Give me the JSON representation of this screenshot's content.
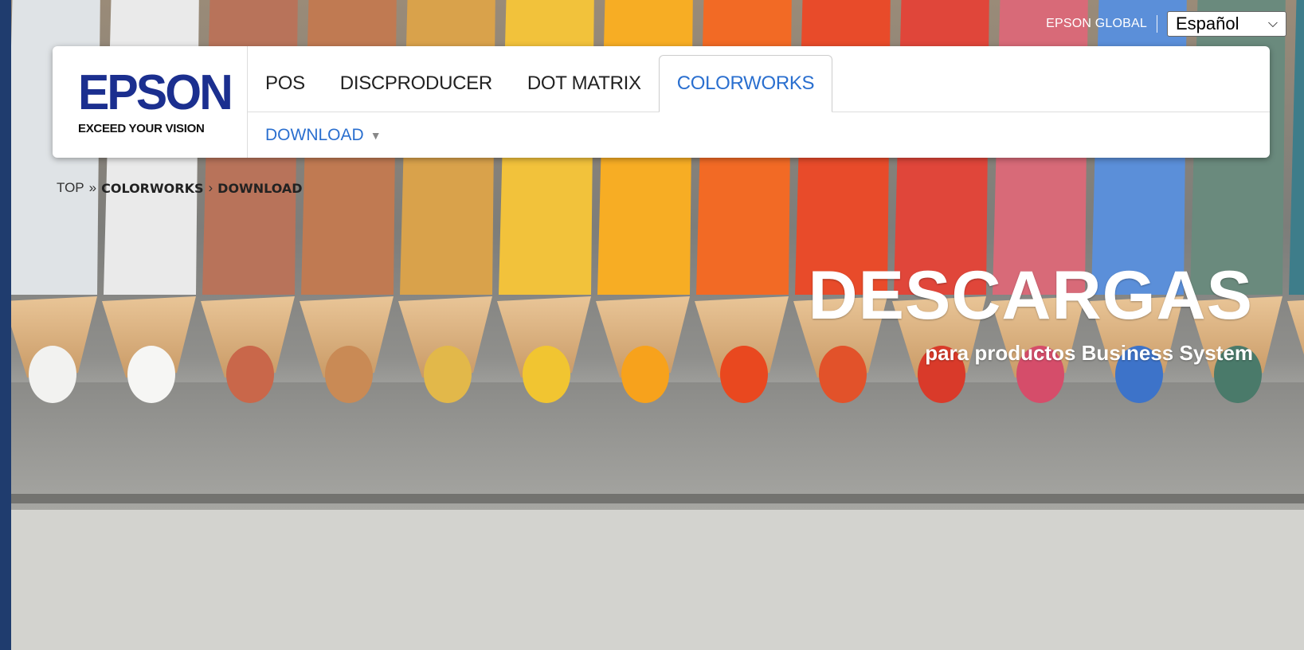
{
  "utility": {
    "global_link": "EPSON GLOBAL",
    "language_selected": "Español"
  },
  "logo": {
    "wordmark": "EPSON",
    "tagline": "EXCEED YOUR VISION"
  },
  "nav": {
    "items": [
      {
        "label": "POS",
        "active": false
      },
      {
        "label": "DISCPRODUCER",
        "active": false
      },
      {
        "label": "DOT MATRIX",
        "active": false
      },
      {
        "label": "COLORWORKS",
        "active": true
      }
    ],
    "sub_item": "DOWNLOAD"
  },
  "breadcrumb": {
    "top": "TOP",
    "sep1": "»",
    "section": "COLORWORKS",
    "sep2": "›",
    "page": "DOWNLOAD"
  },
  "hero": {
    "title": "DESCARGAS",
    "subtitle": "para productos Business System"
  },
  "colors": {
    "brand_blue": "#1b2f8f",
    "link_blue": "#2a6fcf",
    "left_strip": "#1f3c6e"
  },
  "icons": {
    "language_dropdown": "chevron-down-icon",
    "download_menu": "caret-down-icon"
  }
}
